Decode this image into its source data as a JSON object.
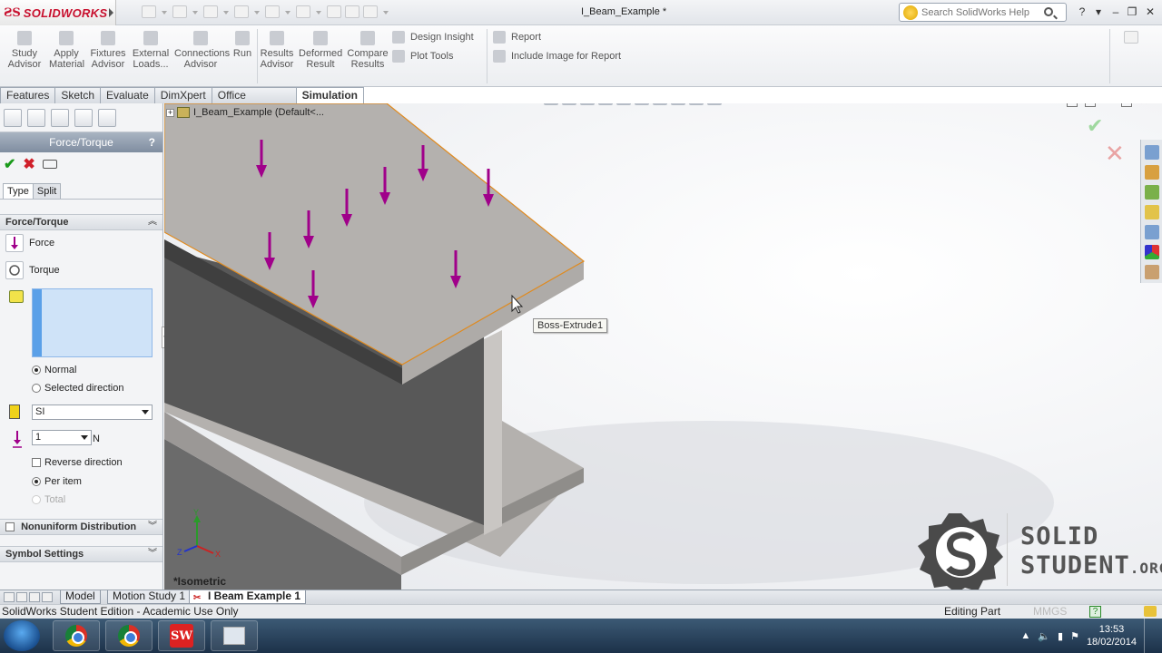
{
  "app": {
    "brand": "SOLIDWORKS",
    "document_title": "I_Beam_Example *",
    "search_placeholder": "Search SolidWorks Help"
  },
  "command_manager": {
    "study_advisor": "Study Advisor",
    "apply_material": "Apply Material",
    "fixtures_advisor": "Fixtures Advisor",
    "external_loads": "External Loads...",
    "connections_advisor": "Connections Advisor",
    "run": "Run",
    "results_advisor": "Results Advisor",
    "deformed_result": "Deformed Result",
    "compare_results": "Compare Results",
    "design_insight": "Design Insight",
    "plot_tools": "Plot Tools",
    "report": "Report",
    "include_image": "Include Image for Report"
  },
  "tabs": [
    "Features",
    "Sketch",
    "Evaluate",
    "DimXpert",
    "Office Products",
    "Simulation"
  ],
  "active_tab": "Simulation",
  "property_manager": {
    "title": "Force/Torque",
    "help": "?",
    "subtabs": [
      "Type",
      "Split"
    ],
    "group_force_torque": "Force/Torque",
    "force_label": "Force",
    "torque_label": "Torque",
    "normal_label": "Normal",
    "selected_direction_label": "Selected direction",
    "unit_system": "SI",
    "force_value": "1",
    "force_unit": "N",
    "reverse_direction_label": "Reverse direction",
    "per_item_label": "Per item",
    "total_label": "Total",
    "group_nonuniform": "Nonuniform Distribution",
    "group_symbol": "Symbol Settings"
  },
  "viewport": {
    "tree_node": "I_Beam_Example  (Default<...",
    "tooltip": "Boss-Extrude1",
    "view_label": "*Isometric",
    "watermark_line1": "SOLID",
    "watermark_line2": "STUDENT",
    "watermark_suffix": ".ORG"
  },
  "bottom_tabs": [
    "Model",
    "Motion Study 1",
    "I Beam Example 1"
  ],
  "active_bottom_tab": "I Beam Example 1",
  "status_bar": {
    "edition": "SolidWorks Student Edition - Academic Use Only",
    "mode": "Editing Part",
    "units": "MMGS"
  },
  "taskbar": {
    "time": "13:53",
    "date": "18/02/2014"
  },
  "colors": {
    "load_arrow": "#a0008a",
    "edge_highlight": "#e08a1e",
    "beam_face": "#b4b1ae",
    "beam_side": "#6b6b6b"
  }
}
